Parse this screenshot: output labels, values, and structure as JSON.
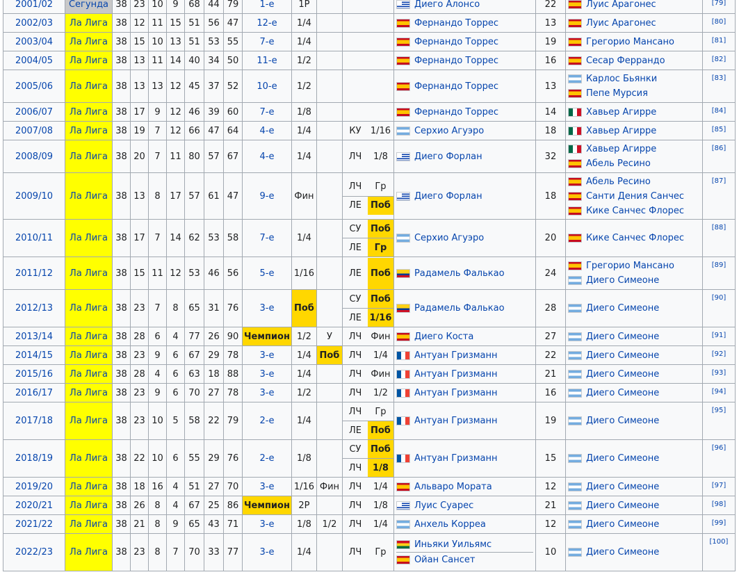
{
  "rows": [
    {
      "season": "2001/02",
      "league": "Сегунда",
      "lg": "g",
      "g": "38",
      "w": "23",
      "d": "10",
      "l": "9",
      "gf": "68",
      "ga": "44",
      "pts": "79",
      "pos": "1-е",
      "cup": "1Р",
      "sc": "",
      "eu": [],
      "scorers": [
        {
          "flag": "esp",
          "name": "Диего Алонсо",
          "flag_c": "uru"
        }
      ],
      "goals": "22",
      "coaches": [
        {
          "flag": "esp",
          "name": "Луис Арагонес"
        }
      ],
      "ref": "[79]"
    },
    {
      "season": "2002/03",
      "league": "Ла Лига",
      "lg": "y",
      "g": "38",
      "w": "12",
      "d": "11",
      "l": "15",
      "gf": "51",
      "ga": "56",
      "pts": "47",
      "pos": "12-е",
      "cup": "1/4",
      "sc": "",
      "eu": [],
      "scorers": [
        {
          "flag": "esp",
          "name": "Фернандо Торрес"
        }
      ],
      "goals": "13",
      "coaches": [
        {
          "flag": "esp",
          "name": "Луис Арагонес"
        }
      ],
      "ref": "[80]"
    },
    {
      "season": "2003/04",
      "league": "Ла Лига",
      "lg": "y",
      "g": "38",
      "w": "15",
      "d": "10",
      "l": "13",
      "gf": "51",
      "ga": "53",
      "pts": "55",
      "pos": "7-е",
      "cup": "1/4",
      "sc": "",
      "eu": [],
      "scorers": [
        {
          "flag": "esp",
          "name": "Фернандо Торрес"
        }
      ],
      "goals": "19",
      "coaches": [
        {
          "flag": "esp",
          "name": "Грегорио Мансано"
        }
      ],
      "ref": "[81]"
    },
    {
      "season": "2004/05",
      "league": "Ла Лига",
      "lg": "y",
      "g": "38",
      "w": "13",
      "d": "11",
      "l": "14",
      "gf": "40",
      "ga": "34",
      "pts": "50",
      "pos": "11-е",
      "cup": "1/2",
      "sc": "",
      "eu": [],
      "scorers": [
        {
          "flag": "esp",
          "name": "Фернандо Торрес"
        }
      ],
      "goals": "16",
      "coaches": [
        {
          "flag": "esp",
          "name": "Сесар Феррандо"
        }
      ],
      "ref": "[82]"
    },
    {
      "season": "2005/06",
      "league": "Ла Лига",
      "lg": "y",
      "g": "38",
      "w": "13",
      "d": "13",
      "l": "12",
      "gf": "45",
      "ga": "37",
      "pts": "52",
      "pos": "10-е",
      "cup": "1/2",
      "sc": "",
      "eu": [],
      "scorers": [
        {
          "flag": "esp",
          "name": "Фернандо Торрес"
        }
      ],
      "goals": "13",
      "coaches": [
        {
          "flag": "arg",
          "name": "Карлос Бьянки"
        },
        {
          "flag": "esp",
          "name": "Пепе Мурсия"
        }
      ],
      "ref": "[83]"
    },
    {
      "season": "2006/07",
      "league": "Ла Лига",
      "lg": "y",
      "g": "38",
      "w": "17",
      "d": "9",
      "l": "12",
      "gf": "46",
      "ga": "39",
      "pts": "60",
      "pos": "7-е",
      "cup": "1/8",
      "sc": "",
      "eu": [],
      "scorers": [
        {
          "flag": "esp",
          "name": "Фернандо Торрес"
        }
      ],
      "goals": "14",
      "coaches": [
        {
          "flag": "mex",
          "name": "Хавьер Агирре"
        }
      ],
      "ref": "[84]"
    },
    {
      "season": "2007/08",
      "league": "Ла Лига",
      "lg": "y",
      "g": "38",
      "w": "19",
      "d": "7",
      "l": "12",
      "gf": "66",
      "ga": "47",
      "pts": "64",
      "pos": "4-е",
      "cup": "1/4",
      "sc": "",
      "eu": [
        {
          "t": "КУ",
          "r": "1/16",
          "gold": false
        }
      ],
      "scorers": [
        {
          "flag": "arg",
          "name": "Серхио Агуэро"
        }
      ],
      "goals": "18",
      "coaches": [
        {
          "flag": "mex",
          "name": "Хавьер Агирре"
        }
      ],
      "ref": "[85]"
    },
    {
      "season": "2008/09",
      "league": "Ла Лига",
      "lg": "y",
      "g": "38",
      "w": "20",
      "d": "7",
      "l": "11",
      "gf": "80",
      "ga": "57",
      "pts": "67",
      "pos": "4-е",
      "cup": "1/4",
      "sc": "",
      "eu": [
        {
          "t": "ЛЧ",
          "r": "1/8",
          "gold": false
        }
      ],
      "scorers": [
        {
          "flag": "uru",
          "name": "Диего Форлан"
        }
      ],
      "goals": "32",
      "coaches": [
        {
          "flag": "mex",
          "name": "Хавьер Агирре"
        },
        {
          "flag": "esp",
          "name": "Абель Ресино"
        }
      ],
      "ref": "[86]"
    },
    {
      "season": "2009/10",
      "league": "Ла Лига",
      "lg": "y",
      "g": "38",
      "w": "13",
      "d": "8",
      "l": "17",
      "gf": "57",
      "ga": "61",
      "pts": "47",
      "pos": "9-е",
      "cup": "Фин",
      "sc": "",
      "eu": [
        {
          "t": "ЛЧ",
          "r": "Гр",
          "gold": false
        },
        {
          "t": "ЛЕ",
          "r": "Поб",
          "gold": true
        }
      ],
      "scorers": [
        {
          "flag": "uru",
          "name": "Диего Форлан"
        }
      ],
      "goals": "18",
      "coaches": [
        {
          "flag": "esp",
          "name": "Абель Ресино"
        },
        {
          "flag": "esp",
          "name": "Санти Дения Санчес"
        },
        {
          "flag": "esp",
          "name": "Кике Санчес Флорес"
        }
      ],
      "ref": "[87]"
    },
    {
      "season": "2010/11",
      "league": "Ла Лига",
      "lg": "y",
      "g": "38",
      "w": "17",
      "d": "7",
      "l": "14",
      "gf": "62",
      "ga": "53",
      "pts": "58",
      "pos": "7-е",
      "cup": "1/4",
      "sc": "",
      "eu": [
        {
          "t": "СУ",
          "r": "Поб",
          "gold": true
        },
        {
          "t": "ЛЕ",
          "r": "Гр",
          "gold": true
        }
      ],
      "scorers": [
        {
          "flag": "arg",
          "name": "Серхио Агуэро"
        }
      ],
      "goals": "20",
      "coaches": [
        {
          "flag": "esp",
          "name": "Кике Санчес Флорес"
        }
      ],
      "ref": "[88]"
    },
    {
      "season": "2011/12",
      "league": "Ла Лига",
      "lg": "y",
      "g": "38",
      "w": "15",
      "d": "11",
      "l": "12",
      "gf": "53",
      "ga": "46",
      "pts": "56",
      "pos": "5-е",
      "cup": "1/16",
      "sc": "",
      "eu": [
        {
          "t": "ЛЕ",
          "r": "Поб",
          "gold": true
        }
      ],
      "scorers": [
        {
          "flag": "col",
          "name": "Радамель Фалькао"
        }
      ],
      "goals": "24",
      "coaches": [
        {
          "flag": "esp",
          "name": "Грегорио Мансано"
        },
        {
          "flag": "arg",
          "name": "Диего Симеоне"
        }
      ],
      "ref": "[89]"
    },
    {
      "season": "2012/13",
      "league": "Ла Лига",
      "lg": "y",
      "g": "38",
      "w": "23",
      "d": "7",
      "l": "8",
      "gf": "65",
      "ga": "31",
      "pts": "76",
      "pos": "3-е",
      "cup": "Поб",
      "cupGold": true,
      "sc": "",
      "eu": [
        {
          "t": "СУ",
          "r": "Поб",
          "gold": true
        },
        {
          "t": "ЛЕ",
          "r": "1/16",
          "gold": true
        }
      ],
      "scorers": [
        {
          "flag": "col",
          "name": "Радамель Фалькао"
        }
      ],
      "goals": "28",
      "coaches": [
        {
          "flag": "arg",
          "name": "Диего Симеоне"
        }
      ],
      "ref": "[90]"
    },
    {
      "season": "2013/14",
      "league": "Ла Лига",
      "lg": "y",
      "g": "38",
      "w": "28",
      "d": "6",
      "l": "4",
      "gf": "77",
      "ga": "26",
      "pts": "90",
      "pos": "Чемпион",
      "posGold": true,
      "cup": "1/2",
      "sc": "У",
      "eu": [
        {
          "t": "ЛЧ",
          "r": "Фин",
          "gold": false
        }
      ],
      "scorers": [
        {
          "flag": "esp",
          "name": "Диего Коста"
        }
      ],
      "goals": "27",
      "coaches": [
        {
          "flag": "arg",
          "name": "Диего Симеоне"
        }
      ],
      "ref": "[91]"
    },
    {
      "season": "2014/15",
      "league": "Ла Лига",
      "lg": "y",
      "g": "38",
      "w": "23",
      "d": "9",
      "l": "6",
      "gf": "67",
      "ga": "29",
      "pts": "78",
      "pos": "3-е",
      "cup": "1/4",
      "sc": "Поб",
      "scGold": true,
      "eu": [
        {
          "t": "ЛЧ",
          "r": "1/4",
          "gold": false
        }
      ],
      "scorers": [
        {
          "flag": "fra",
          "name": "Антуан Гризманн"
        }
      ],
      "goals": "22",
      "coaches": [
        {
          "flag": "arg",
          "name": "Диего Симеоне"
        }
      ],
      "ref": "[92]"
    },
    {
      "season": "2015/16",
      "league": "Ла Лига",
      "lg": "y",
      "g": "38",
      "w": "28",
      "d": "4",
      "l": "6",
      "gf": "63",
      "ga": "18",
      "pts": "88",
      "pos": "3-е",
      "cup": "1/4",
      "sc": "",
      "eu": [
        {
          "t": "ЛЧ",
          "r": "Фин",
          "gold": false
        }
      ],
      "scorers": [
        {
          "flag": "fra",
          "name": "Антуан Гризманн"
        }
      ],
      "goals": "21",
      "coaches": [
        {
          "flag": "arg",
          "name": "Диего Симеоне"
        }
      ],
      "ref": "[93]"
    },
    {
      "season": "2016/17",
      "league": "Ла Лига",
      "lg": "y",
      "g": "38",
      "w": "23",
      "d": "9",
      "l": "6",
      "gf": "70",
      "ga": "27",
      "pts": "78",
      "pos": "3-е",
      "cup": "1/2",
      "sc": "",
      "eu": [
        {
          "t": "ЛЧ",
          "r": "1/2",
          "gold": false
        }
      ],
      "scorers": [
        {
          "flag": "fra",
          "name": "Антуан Гризманн"
        }
      ],
      "goals": "16",
      "coaches": [
        {
          "flag": "arg",
          "name": "Диего Симеоне"
        }
      ],
      "ref": "[94]"
    },
    {
      "season": "2017/18",
      "league": "Ла Лига",
      "lg": "y",
      "g": "38",
      "w": "23",
      "d": "10",
      "l": "5",
      "gf": "58",
      "ga": "22",
      "pts": "79",
      "pos": "2-е",
      "cup": "1/4",
      "sc": "",
      "eu": [
        {
          "t": "ЛЧ",
          "r": "Гр",
          "gold": false
        },
        {
          "t": "ЛЕ",
          "r": "Поб",
          "gold": true
        }
      ],
      "scorers": [
        {
          "flag": "fra",
          "name": "Антуан Гризманн"
        }
      ],
      "goals": "19",
      "coaches": [
        {
          "flag": "arg",
          "name": "Диего Симеоне"
        }
      ],
      "ref": "[95]"
    },
    {
      "season": "2018/19",
      "league": "Ла Лига",
      "lg": "y",
      "g": "38",
      "w": "22",
      "d": "10",
      "l": "6",
      "gf": "55",
      "ga": "29",
      "pts": "76",
      "pos": "2-е",
      "cup": "1/8",
      "sc": "",
      "eu": [
        {
          "t": "СУ",
          "r": "Поб",
          "gold": true
        },
        {
          "t": "ЛЧ",
          "r": "1/8",
          "gold": true
        }
      ],
      "scorers": [
        {
          "flag": "fra",
          "name": "Антуан Гризманн"
        }
      ],
      "goals": "15",
      "coaches": [
        {
          "flag": "arg",
          "name": "Диего Симеоне"
        }
      ],
      "ref": "[96]"
    },
    {
      "season": "2019/20",
      "league": "Ла Лига",
      "lg": "y",
      "g": "38",
      "w": "18",
      "d": "16",
      "l": "4",
      "gf": "51",
      "ga": "27",
      "pts": "70",
      "pos": "3-е",
      "cup": "1/16",
      "sc": "Фин",
      "eu": [
        {
          "t": "ЛЧ",
          "r": "1/4",
          "gold": false
        }
      ],
      "scorers": [
        {
          "flag": "esp",
          "name": "Альваро Мората"
        }
      ],
      "goals": "12",
      "coaches": [
        {
          "flag": "arg",
          "name": "Диего Симеоне"
        }
      ],
      "ref": "[97]"
    },
    {
      "season": "2020/21",
      "league": "Ла Лига",
      "lg": "y",
      "g": "38",
      "w": "26",
      "d": "8",
      "l": "4",
      "gf": "67",
      "ga": "25",
      "pts": "86",
      "pos": "Чемпион",
      "posGold": true,
      "cup": "2Р",
      "sc": "",
      "eu": [
        {
          "t": "ЛЧ",
          "r": "1/8",
          "gold": false
        }
      ],
      "scorers": [
        {
          "flag": "uru",
          "name": "Луис Суарес"
        }
      ],
      "goals": "21",
      "coaches": [
        {
          "flag": "arg",
          "name": "Диего Симеоне"
        }
      ],
      "ref": "[98]"
    },
    {
      "season": "2021/22",
      "league": "Ла Лига",
      "lg": "y",
      "g": "38",
      "w": "21",
      "d": "8",
      "l": "9",
      "gf": "65",
      "ga": "43",
      "pts": "71",
      "pos": "3-е",
      "cup": "1/8",
      "sc": "1/2",
      "eu": [
        {
          "t": "ЛЧ",
          "r": "1/4",
          "gold": false
        }
      ],
      "scorers": [
        {
          "flag": "arg",
          "name": "Анхель Корреа"
        }
      ],
      "goals": "12",
      "coaches": [
        {
          "flag": "arg",
          "name": "Диего Симеоне"
        }
      ],
      "ref": "[99]"
    },
    {
      "season": "2022/23",
      "league": "Ла Лига",
      "lg": "y",
      "g": "38",
      "w": "23",
      "d": "8",
      "l": "7",
      "gf": "70",
      "ga": "33",
      "pts": "77",
      "pos": "3-е",
      "cup": "1/4",
      "sc": "",
      "eu": [
        {
          "t": "ЛЧ",
          "r": "Гр",
          "gold": false
        }
      ],
      "scorers": [
        {
          "flag": "gha",
          "name": "Иньяки Уильямс"
        },
        {
          "flag": "esp",
          "name": "Ойан Сансет"
        }
      ],
      "goals": "10",
      "coaches": [
        {
          "flag": "arg",
          "name": "Диего Симеоне"
        }
      ],
      "ref": "[100]"
    }
  ],
  "colors": {
    "gold": "#ffd700",
    "laliga": "#ffff00",
    "segunda": "#c8c8c8",
    "link": "#0645ad",
    "border": "#a2a9b1"
  }
}
